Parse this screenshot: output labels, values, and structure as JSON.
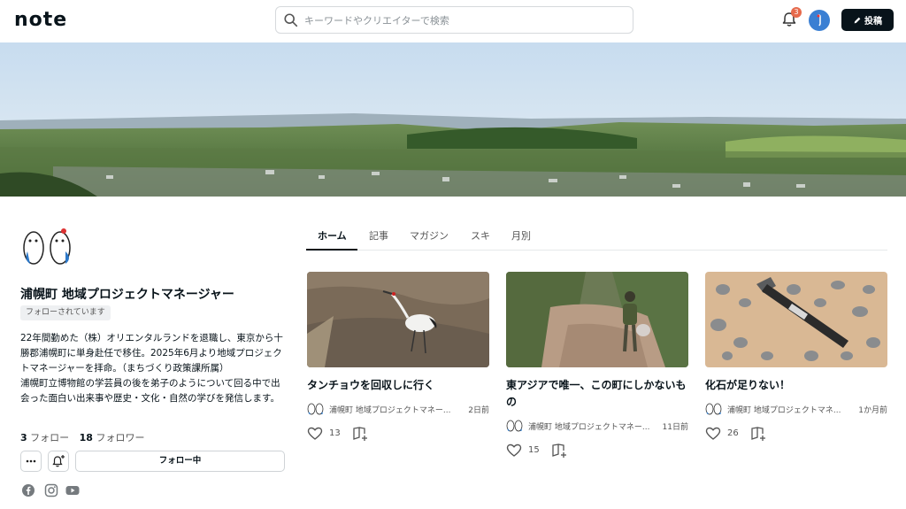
{
  "header": {
    "logo": "note",
    "search_placeholder": "キーワードやクリエイターで検索",
    "notification_count": "3",
    "post_label": "投稿"
  },
  "profile": {
    "name": "浦幌町 地域プロジェクトマネージャー",
    "follow_status": "フォローされています",
    "bio": "22年間勤めた（株）オリエンタルランドを退職し、東京から十勝郡浦幌町に単身赴任で移住。2025年6月より地域プロジェクトマネージャーを拝命。（まちづくり政策課所属）\n浦幌町立博物館の学芸員の後を弟子のようについて回る中で出会った面白い出来事や歴史・文化・自然の学びを発信します。",
    "following_count": "3",
    "following_label": "フォロー",
    "followers_count": "18",
    "followers_label": "フォロワー",
    "follow_button": "フォロー中"
  },
  "tabs": [
    "ホーム",
    "記事",
    "マガジン",
    "スキ",
    "月別"
  ],
  "cards": [
    {
      "title": "タンチョウを回収しに行く",
      "author": "浦幌町 地域プロジェクトマネー...",
      "time": "2日前",
      "likes": "13"
    },
    {
      "title": "東アジアで唯一、この町にしかないもの",
      "author": "浦幌町 地域プロジェクトマネー...",
      "time": "11日前",
      "likes": "15"
    },
    {
      "title": "化石が足りない！",
      "author": "浦幌町 地域プロジェクトマネ...",
      "time": "1か月前",
      "likes": "26"
    }
  ],
  "icons": {
    "search": "search-icon",
    "bell": "bell-icon",
    "pen": "pen-icon",
    "more": "more-icon",
    "bell_add": "bell-plus-icon",
    "heart": "heart-icon",
    "magazine": "magazine-add-icon",
    "facebook": "facebook-icon",
    "instagram": "instagram-icon",
    "youtube": "youtube-icon"
  },
  "colors": {
    "text": "#08131a",
    "badge": "#e66a4c",
    "avatar": "#3a7fd3",
    "post_button": "#08131a"
  }
}
